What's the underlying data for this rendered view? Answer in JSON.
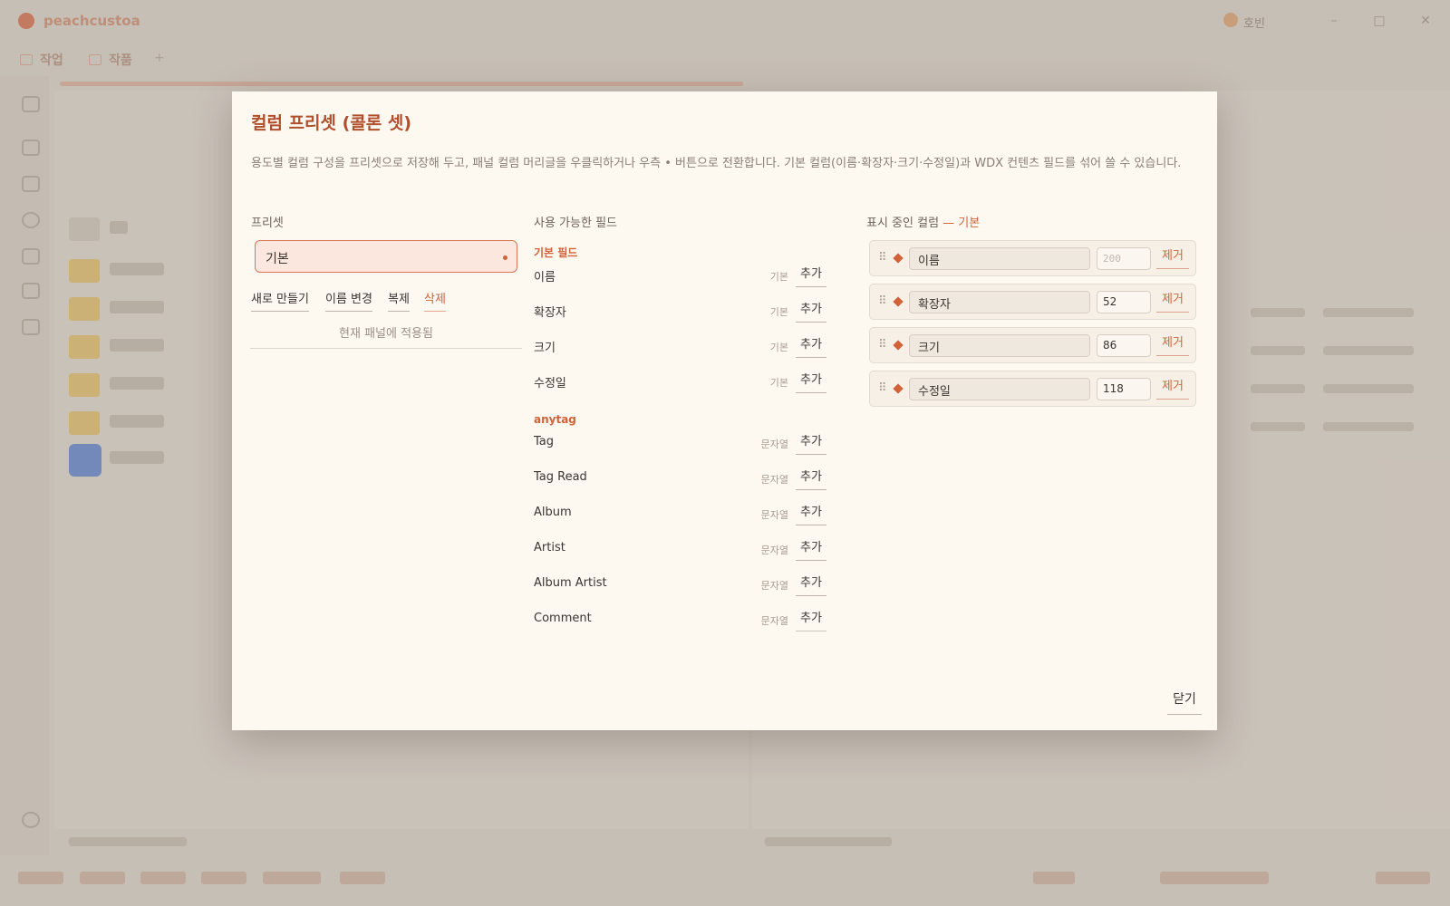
{
  "app": {
    "brand": "peachcustoa",
    "tabs": [
      "작업",
      "작품"
    ],
    "user": "호빈"
  },
  "modal": {
    "title": "컬럼 프리셋 (콜론 셋)",
    "description": "용도별 컬럼 구성을 프리셋으로 저장해 두고, 패널 컬럼 머리글을 우클릭하거나 우측 • 버튼으로 전환합니다. 기본 컬럼(이름·확장자·크기·수정일)과 WDX 컨텐츠 필드를 섞어 쓸 수 있습니다.",
    "close_label": "닫기"
  },
  "presets": {
    "heading": "프리셋",
    "selected": "기본",
    "buttons": {
      "new": "새로 만들기",
      "rename": "이름 변경",
      "duplicate": "복제",
      "delete": "삭제"
    },
    "applied_status": "현재 패널에 적용됨"
  },
  "available": {
    "heading": "사용 가능한 필드",
    "add_label": "추가",
    "groups": [
      {
        "name": "기본 필드",
        "fields": [
          {
            "name": "이름",
            "type": "기본"
          },
          {
            "name": "확장자",
            "type": "기본"
          },
          {
            "name": "크기",
            "type": "기본"
          },
          {
            "name": "수정일",
            "type": "기본"
          }
        ]
      },
      {
        "name": "anytag",
        "fields": [
          {
            "name": "Tag",
            "type": "문자열"
          },
          {
            "name": "Tag Read",
            "type": "문자열"
          },
          {
            "name": "Album",
            "type": "문자열"
          },
          {
            "name": "Artist",
            "type": "문자열"
          },
          {
            "name": "Album Artist",
            "type": "문자열"
          },
          {
            "name": "Comment",
            "type": "문자열"
          }
        ]
      }
    ]
  },
  "active": {
    "heading": "표시 중인 컬럼",
    "heading_preset": "— 기본",
    "remove_label": "제거",
    "columns": [
      {
        "name": "이름",
        "width": "",
        "width_placeholder": "200"
      },
      {
        "name": "확장자",
        "width": "52"
      },
      {
        "name": "크기",
        "width": "86"
      },
      {
        "name": "수정일",
        "width": "118"
      }
    ]
  },
  "colors": {
    "accent": "#d1623a",
    "title": "#b14f2d",
    "modal_bg": "#fdf9f1"
  }
}
